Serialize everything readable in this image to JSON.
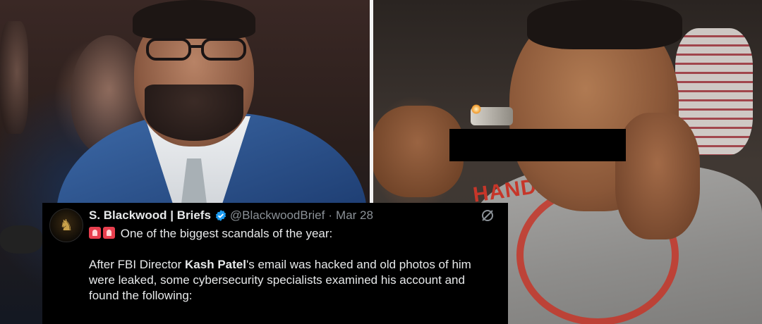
{
  "tweet": {
    "display_name": "S. Blackwood | Briefs",
    "handle": "@BlackwoodBrief",
    "separator": "·",
    "date": "Mar 28",
    "line1": "One of the biggest scandals of the year:",
    "p2_pre": "After FBI Director ",
    "p2_bold": "Kash Patel",
    "p2_mid": "'s email was hacked and old photos of him",
    "p2_line2": "were leaked, some cybersecurity specialists examined his account and",
    "p2_line3": "found the following:"
  },
  "shirt_print_text": "HANDALA",
  "colors": {
    "verified": "#1d9bf0",
    "siren": "#e83f4e",
    "tweet_bg": "#000000",
    "tweet_text": "#e7e9ea",
    "muted": "#8b9197",
    "print_red": "#c63629"
  },
  "icons": [
    "siren-icon",
    "verified-badge-icon",
    "grok-icon",
    "avatar-icon"
  ]
}
